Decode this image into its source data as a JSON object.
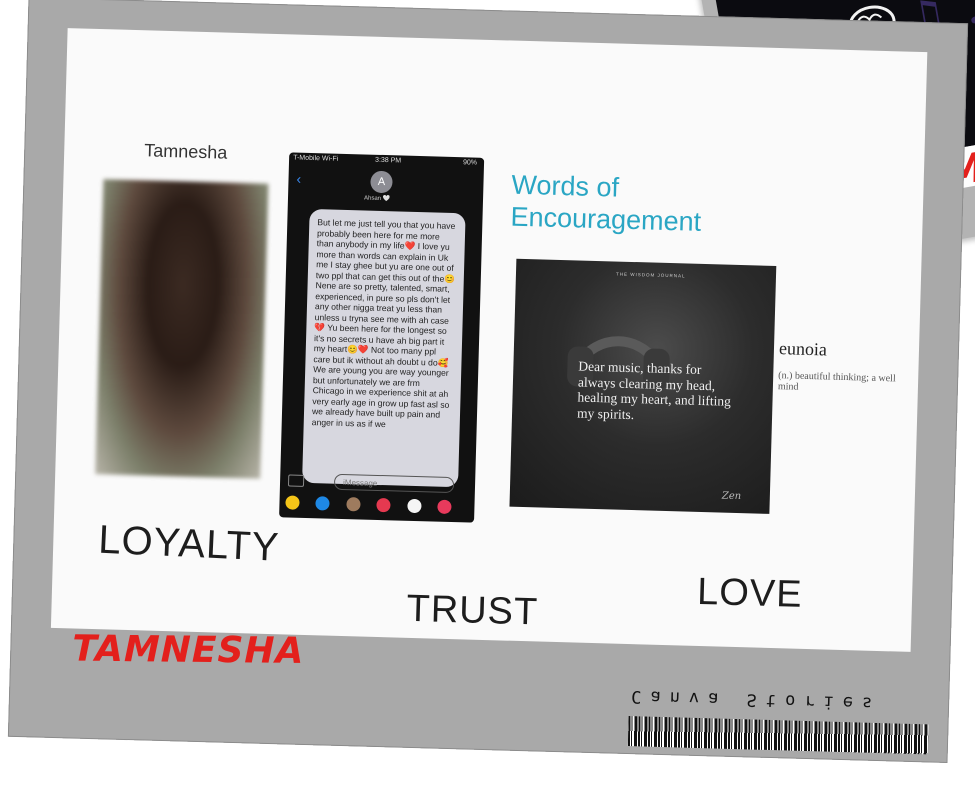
{
  "collage": {
    "name_label": "Tamnesha",
    "heading_line1": "Words of",
    "heading_line2": "Encouragement",
    "word_loyalty": "LOYALTY",
    "word_trust": "TRUST",
    "word_love": "LOVE",
    "definition_word": "eunoia",
    "definition_text": "(n.) beautiful thinking; a well mind",
    "signature_red": "TAMNESHA",
    "brand_mirrored": "Canva Stories",
    "second_frame_red": "M"
  },
  "phone": {
    "status_left": "T-Mobile Wi-Fi",
    "status_time": "3:38 PM",
    "status_right": "90%",
    "contact_initial": "A",
    "contact_name": "Ahsan 🤍",
    "message": "But let me just tell you that you have probably been here for me more than anybody in my life❤️ I love yu more than words can explain in Uk me I stay ghee but yu are one out of two ppl that can get this out of the😊 Nene are so pretty, talented, smart, experienced, in pure so pls don't let any other nigga treat yu less than unless u tryna see me with ah case💔 Yu been here for the longest so it's no secrets u have ah big part it my heart😊❤️ Not too many ppl care but ik without ah doubt u do🥰 We are young you are way younger but unfortunately we are frm Chicago in we experience shit at ah very early age in grow up fast asl so we already have built up pain and anger in us as if we",
    "input_placeholder": "iMessage"
  },
  "quote_image": {
    "brand": "THE WISDOM JOURNAL",
    "text": "Dear music, thanks for always clearing my head, healing my heart, and lifting my spirits.",
    "signature": "Zen"
  },
  "colors": {
    "frame_gray": "#a9a9a9",
    "accent_teal": "#2aa6c4",
    "accent_red": "#e3201c"
  }
}
